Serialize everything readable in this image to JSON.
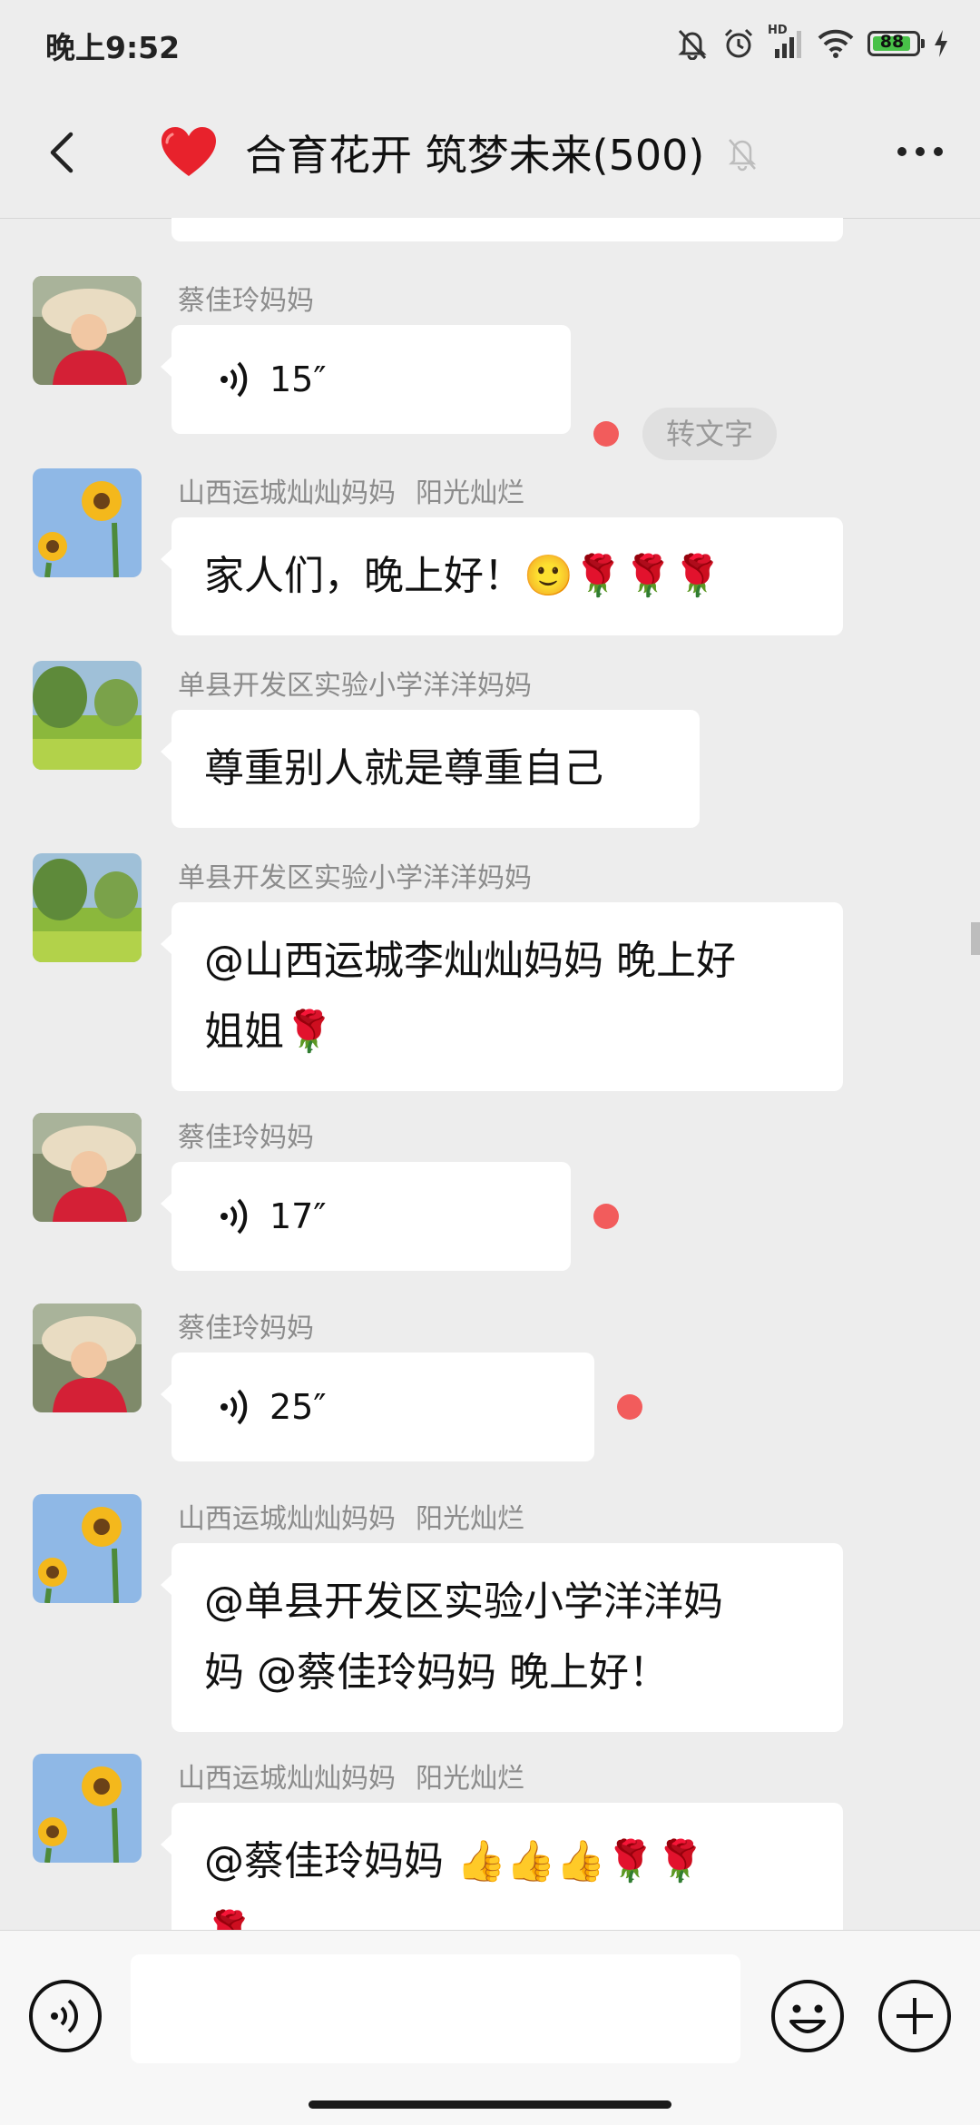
{
  "status_bar": {
    "time": "晚上9:52",
    "signal_label": "HD",
    "battery": "88",
    "icons": [
      "mute-bell-icon",
      "alarm-icon",
      "signal-icon",
      "wifi-icon",
      "battery-icon",
      "charging-icon"
    ]
  },
  "nav": {
    "back_icon": "chevron-left-icon",
    "title": "合育花开 筑梦未来(500)",
    "more_icon": "more-dots-icon"
  },
  "messages": [
    {
      "sender": "蔡佳玲妈妈",
      "type": "voice",
      "duration": "15″",
      "unread": true,
      "convert_label": "转文字"
    },
    {
      "sender": "山西运城灿灿妈妈",
      "sender_tag": "阳光灿烂",
      "type": "text",
      "lines": [
        "家人们，晚上好！🙂🌹🌹🌹"
      ]
    },
    {
      "sender": "单县开发区实验小学洋洋妈妈",
      "type": "text",
      "lines": [
        "尊重别人就是尊重自己"
      ]
    },
    {
      "sender": "单县开发区实验小学洋洋妈妈",
      "type": "text",
      "lines": [
        "@山西运城李灿灿妈妈  晚上好",
        "姐姐🌹"
      ]
    },
    {
      "sender": "蔡佳玲妈妈",
      "type": "voice",
      "duration": "17″",
      "unread": true
    },
    {
      "sender": "蔡佳玲妈妈",
      "type": "voice",
      "duration": "25″",
      "unread": true
    },
    {
      "sender": "山西运城灿灿妈妈",
      "sender_tag": "阳光灿烂",
      "type": "text",
      "lines": [
        "@单县开发区实验小学洋洋妈",
        "妈  @蔡佳玲妈妈  晚上好！"
      ]
    },
    {
      "sender": "山西运城灿灿妈妈",
      "sender_tag": "阳光灿烂",
      "type": "text",
      "lines": [
        "@蔡佳玲妈妈  👍👍👍🌹🌹",
        "🌹"
      ]
    }
  ],
  "input_bar": {
    "voice_icon": "voice-input-icon",
    "input_value": "",
    "emoji_icon": "emoji-icon",
    "plus_icon": "plus-icon"
  }
}
